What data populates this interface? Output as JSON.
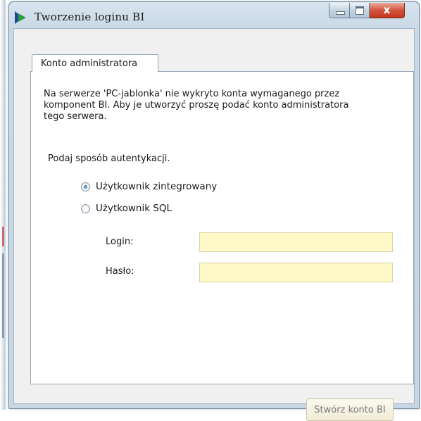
{
  "window": {
    "title": "Tworzenie loginu BI",
    "controls": {
      "minimize_icon": "minimize-icon",
      "maximize_icon": "maximize-icon",
      "close_glyph": "x"
    }
  },
  "tabs": [
    {
      "label": "Konto administratora",
      "active": true
    }
  ],
  "panel": {
    "description_lines": [
      "Na serwerze 'PC-jablonka' nie wykryto konta wymaganego przez",
      "komponent BI. Aby je utworzyć proszę podać konto administratora",
      "tego serwera."
    ],
    "auth_prompt": "Podaj sposób autentykacji.",
    "auth_options": [
      {
        "label": "Użytkownik zintegrowany",
        "checked": true
      },
      {
        "label": "Użytkownik SQL",
        "checked": false
      }
    ],
    "fields": [
      {
        "label": "Login:",
        "value": "",
        "placeholder": ""
      },
      {
        "label": "Hasło:",
        "value": "",
        "placeholder": ""
      }
    ]
  },
  "footer": {
    "create_button": "Stwórz konto BI",
    "create_button_enabled": false
  },
  "colors": {
    "input_background": "#fff9c8",
    "close_button": "#c2361c",
    "app_icon": [
      "#1e4d8c",
      "#2e9b46"
    ]
  }
}
